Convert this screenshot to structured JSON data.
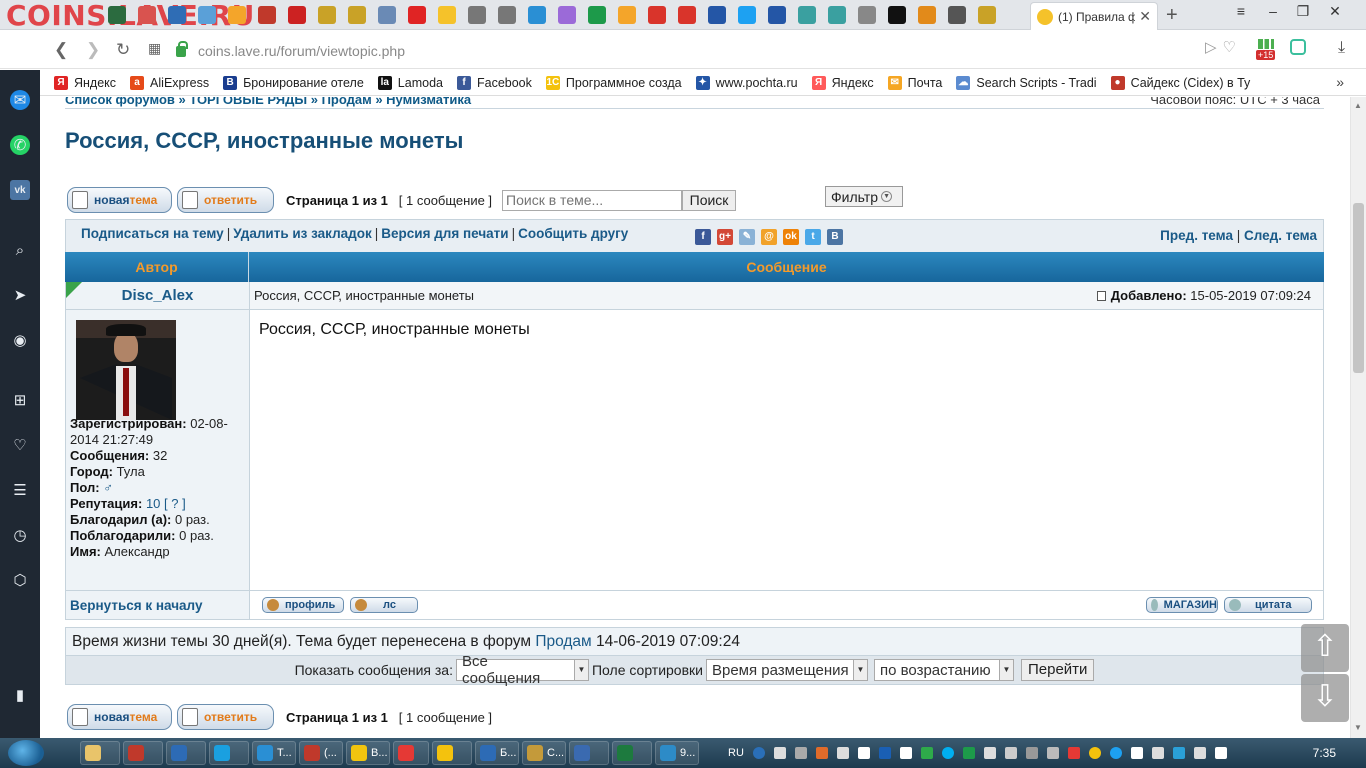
{
  "browser": {
    "watermark": "COINS.LAVE.RU",
    "active_tab_title": "(1) Правила ф",
    "url": "coins.lave.ru/forum/viewtopic.php",
    "badge_count": "+15",
    "bookmarks": [
      {
        "label": "Яндекс",
        "color": "#e02424",
        "glyph": "Я"
      },
      {
        "label": "AliExpress",
        "color": "#e64a19",
        "glyph": "a"
      },
      {
        "label": "Бронирование отеле",
        "color": "#1a3d8f",
        "glyph": "B"
      },
      {
        "label": "Lamoda",
        "color": "#111111",
        "glyph": "la"
      },
      {
        "label": "Facebook",
        "color": "#3b5998",
        "glyph": "f"
      },
      {
        "label": "Программное созда",
        "color": "#f4c20d",
        "glyph": "1C"
      },
      {
        "label": "www.pochta.ru",
        "color": "#2456a6",
        "glyph": "✦"
      },
      {
        "label": "Яндекс",
        "color": "#ff5a5a",
        "glyph": "Я"
      },
      {
        "label": "Почта",
        "color": "#f5a623",
        "glyph": "✉"
      },
      {
        "label": "Search Scripts - Tradi",
        "color": "#5b8bd0",
        "glyph": "☁"
      },
      {
        "label": "Сайдекс (Cidex) в Ту",
        "color": "#c0392b",
        "glyph": "●"
      }
    ]
  },
  "forum": {
    "breadcrumbs": "Список форумов » ТОРГОВЫЕ РЯДЫ » Продам » Нумизматика",
    "timezone": "Часовой пояс: UTC + 3 часа",
    "title": "Россия, СССР, иностранные монеты",
    "buttons": {
      "new_topic_a": "новая ",
      "new_topic_b": "тема",
      "reply": "ответить"
    },
    "pagination": {
      "page": "Страница 1 из 1",
      "count": "[ 1 сообщение ]"
    },
    "search": {
      "placeholder": "Поиск в теме...",
      "button": "Поиск"
    },
    "filter": "Фильтр",
    "topic_links": {
      "subscribe": "Подписаться на тему",
      "remove_bookmark": "Удалить из закладок",
      "print": "Версия для печати",
      "tell_friend": "Сообщить другу",
      "prev": "Пред. тема",
      "next": "След. тема"
    },
    "social_icons": [
      {
        "name": "facebook-icon",
        "color": "#3b5998",
        "glyph": "f"
      },
      {
        "name": "googleplus-icon",
        "color": "#d34836",
        "glyph": "g+"
      },
      {
        "name": "livejournal-icon",
        "color": "#8ab2d6",
        "glyph": "✎"
      },
      {
        "name": "mailru-icon",
        "color": "#f1a22a",
        "glyph": "@"
      },
      {
        "name": "odnoklassniki-icon",
        "color": "#ee8208",
        "glyph": "ok"
      },
      {
        "name": "twitter-icon",
        "color": "#4aa8e8",
        "glyph": "t"
      },
      {
        "name": "vkontakte-icon",
        "color": "#4c75a3",
        "glyph": "B"
      }
    ],
    "table": {
      "col_author": "Автор",
      "col_message": "Сообщение"
    },
    "post": {
      "author": "Disc_Alex",
      "subject": "Россия, СССР, иностранные монеты",
      "added_label": "Добавлено:",
      "added_value": "15-05-2019 07:09:24",
      "body": "Россия, СССР, иностранные монеты",
      "registered_label": "Зарегистрирован:",
      "registered_value": "02-08-2014 21:27:49",
      "messages_label": "Сообщения:",
      "messages_value": "32",
      "city_label": "Город:",
      "city_value": "Тула",
      "sex_label": "Пол:",
      "sex_value": "♂",
      "reputation_label": "Репутация:",
      "reputation_value": "10",
      "reputation_link": "?",
      "thanked_label": "Благодарил (а):",
      "thanked_value": "0 раз.",
      "got_thanks_label": "Поблагодарили:",
      "got_thanks_value": "0 раз.",
      "name_label": "Имя:",
      "name_value": "Александр"
    },
    "post_footer": {
      "back_to_top": "Вернуться к началу",
      "profile": "профиль",
      "pm": "лс",
      "shop": "МАГАЗИН",
      "quote": "цитата"
    },
    "lifetime": {
      "text": "Время жизни темы 30 дней(я). Тема будет перенесена в форум",
      "forum_link": "Продам",
      "date": "14-06-2019 07:09:24"
    },
    "sort": {
      "show_label": "Показать сообщения за:",
      "show_value": "Все сообщения",
      "field_label": "Поле сортировки",
      "field_value": "Время размещения",
      "order_value": "по возрастанию",
      "go": "Перейти"
    },
    "float_buttons": {
      "up": "⇧",
      "down": "⇩"
    }
  },
  "taskbar": {
    "items": [
      {
        "label": "",
        "color": "#e9c46a"
      },
      {
        "label": "",
        "color": "#c0392b"
      },
      {
        "label": "",
        "color": "#2d6bb5"
      },
      {
        "label": "",
        "color": "#1aa0e0"
      },
      {
        "label": "T...",
        "color": "#2a8fd4"
      },
      {
        "label": "(...",
        "color": "#c0392b"
      },
      {
        "label": "B...",
        "color": "#f1c40f"
      },
      {
        "label": "",
        "color": "#e53935"
      },
      {
        "label": "",
        "color": "#f4c20d"
      },
      {
        "label": "Б...",
        "color": "#2d6bb5"
      },
      {
        "label": "С...",
        "color": "#c49a3a"
      },
      {
        "label": "",
        "color": "#3a6ab0"
      },
      {
        "label": "",
        "color": "#1d7a3e"
      },
      {
        "label": "9...",
        "color": "#2d8bc7"
      }
    ],
    "lang": "RU",
    "clock": "7:35"
  }
}
